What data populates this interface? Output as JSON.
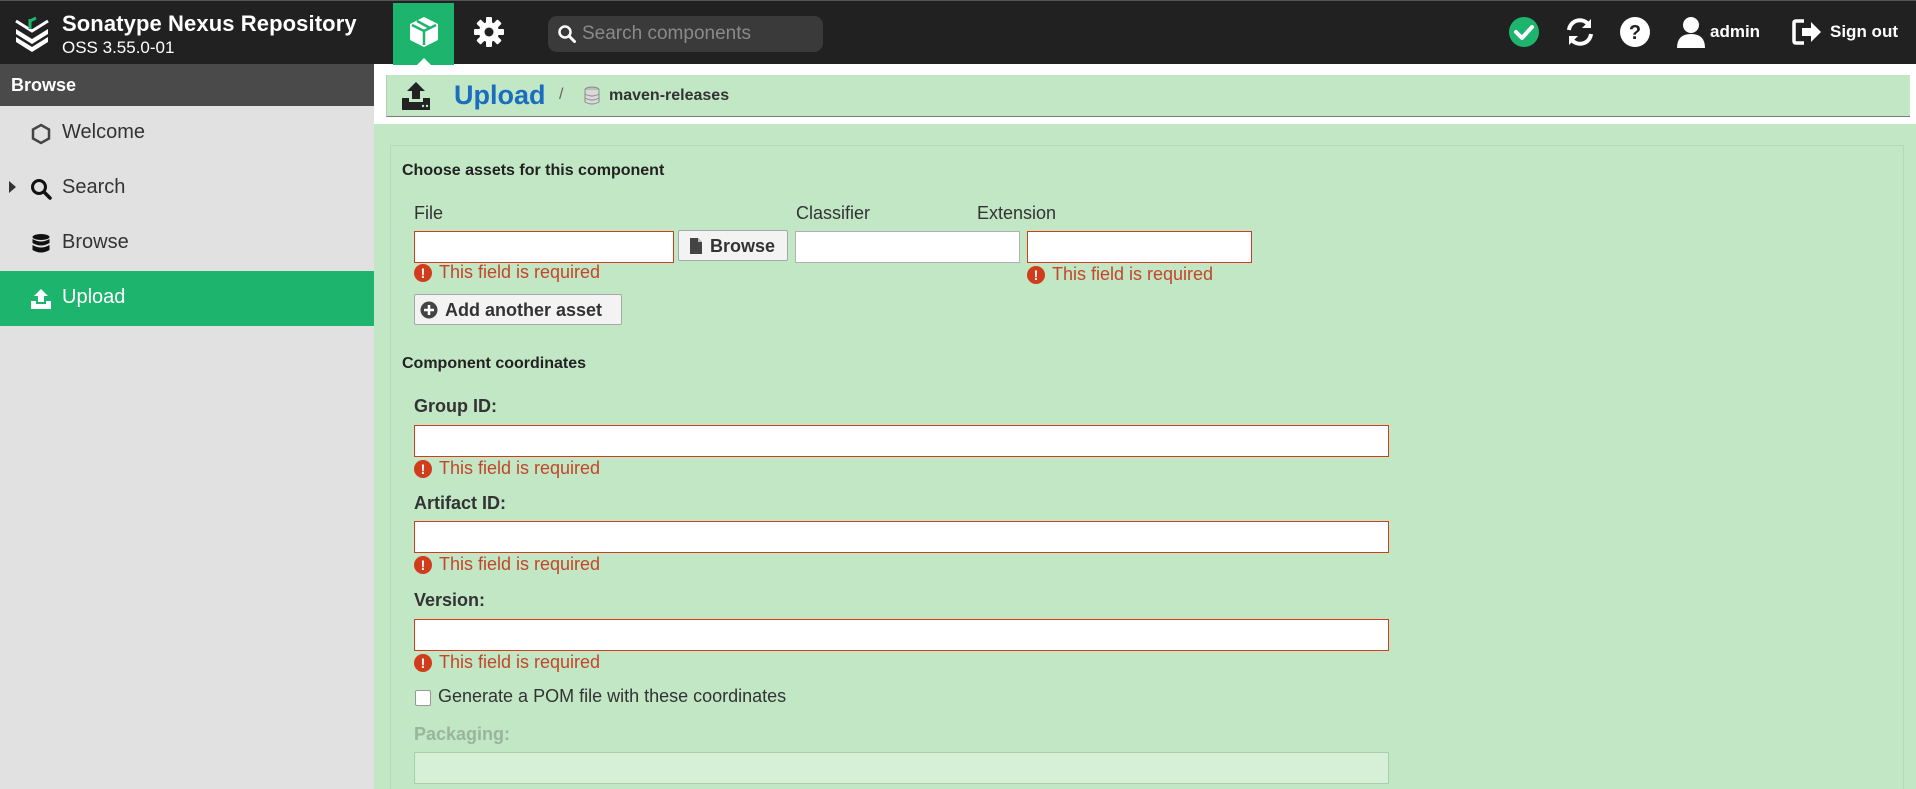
{
  "header": {
    "brand_title": "Sonatype Nexus Repository",
    "brand_version": "OSS 3.55.0-01",
    "search_placeholder": "Search components",
    "user": "admin",
    "sign_out": "Sign out",
    "status_color": "#1db56e",
    "accent_color": "#1db56e",
    "icons": [
      "browse-cube-icon",
      "gear-icon",
      "search-icon",
      "status-ok-icon",
      "refresh-icon",
      "help-icon",
      "user-icon",
      "sign-out-icon"
    ]
  },
  "sidebar": {
    "header": "Browse",
    "items": [
      {
        "label": "Welcome",
        "icon": "hexagon-icon",
        "active": false
      },
      {
        "label": "Search",
        "icon": "search-icon",
        "active": false,
        "expandable": true
      },
      {
        "label": "Browse",
        "icon": "database-icon",
        "active": false
      },
      {
        "label": "Upload",
        "icon": "upload-icon",
        "active": true
      }
    ]
  },
  "breadcrumb": {
    "title": "Upload",
    "separator": "/",
    "repository": "maven-releases"
  },
  "form": {
    "assets_section": "Choose assets for this component",
    "file_label": "File",
    "browse_label": "Browse",
    "classifier_label": "Classifier",
    "extension_label": "Extension",
    "add_asset_label": "Add another asset",
    "required_error": "This field is required",
    "coordinates_section": "Component coordinates",
    "group_id_label": "Group ID:",
    "artifact_id_label": "Artifact ID:",
    "version_label": "Version:",
    "generate_pom_label": "Generate a POM file with these coordinates",
    "packaging_label": "Packaging:",
    "values": {
      "file": "",
      "classifier": "",
      "extension": "",
      "group_id": "",
      "artifact_id": "",
      "version": "",
      "packaging": "",
      "generate_pom": false
    },
    "error_color": "#d13d1c"
  }
}
